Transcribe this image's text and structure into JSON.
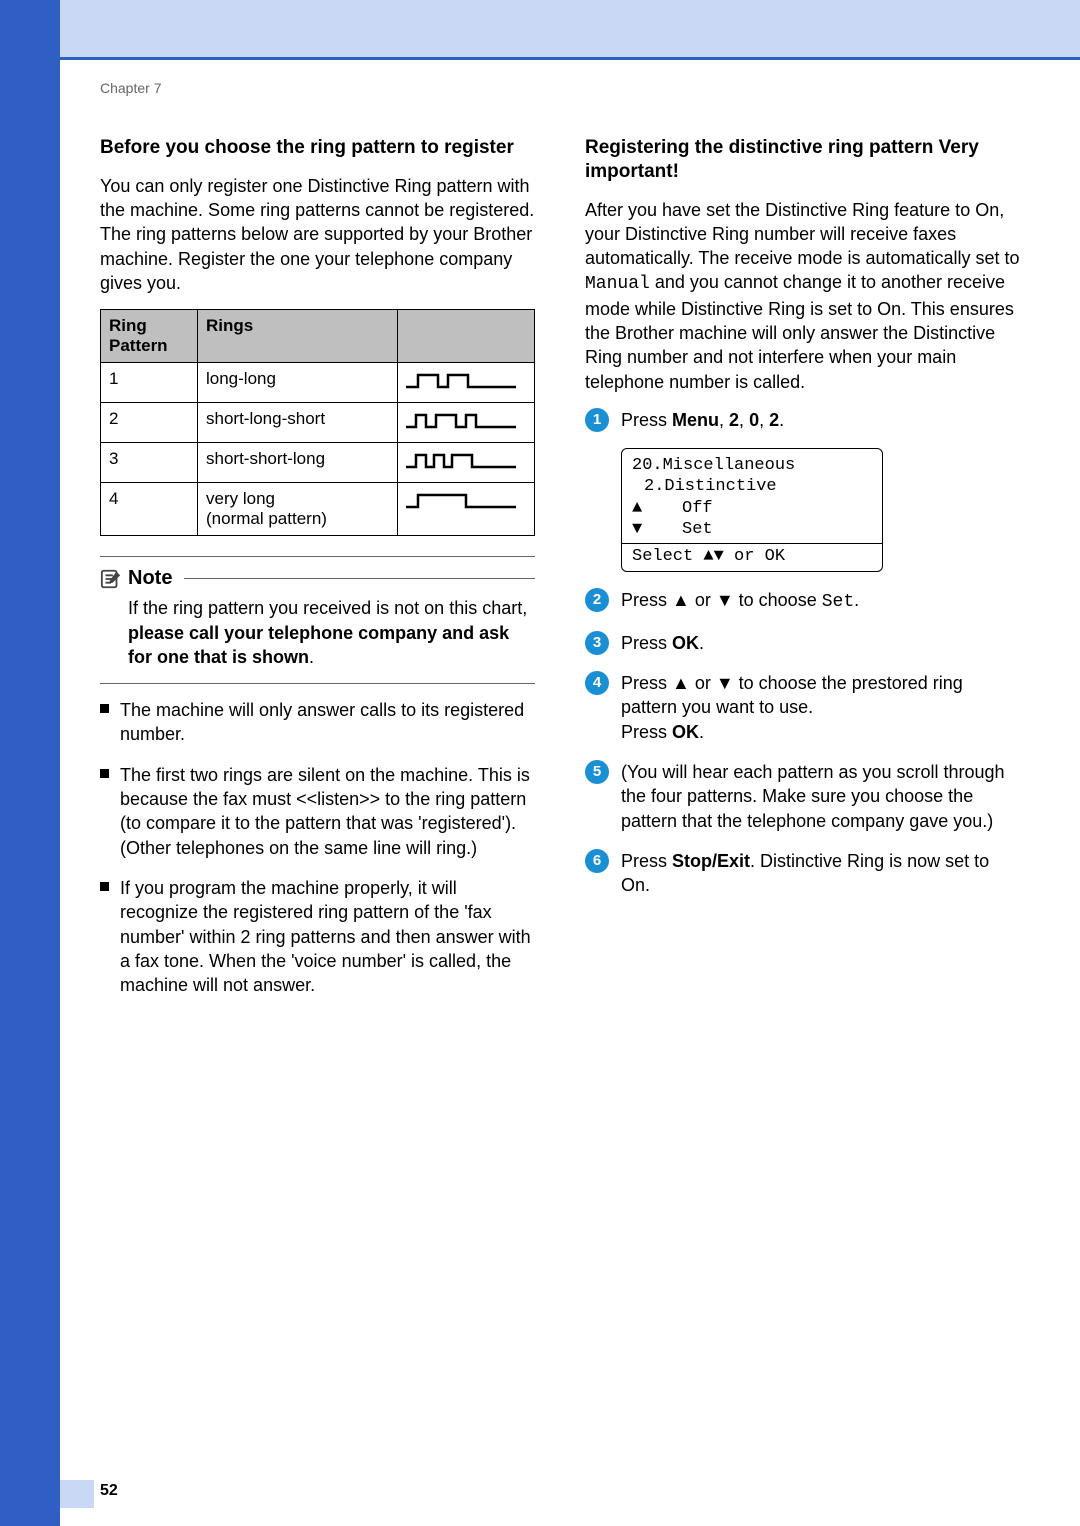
{
  "chapter": "Chapter 7",
  "left": {
    "heading": "Before you choose the ring pattern to register",
    "intro": "You can only register one Distinctive Ring pattern with the machine. Some ring patterns cannot be registered. The ring patterns below are supported by your Brother machine. Register the one your telephone company gives you.",
    "table": {
      "headers": [
        "Ring Pattern",
        "Rings"
      ],
      "rows": [
        {
          "n": "1",
          "desc": "long-long"
        },
        {
          "n": "2",
          "desc": "short-long-short"
        },
        {
          "n": "3",
          "desc": "short-short-long"
        },
        {
          "n": "4",
          "desc": "very long\n(normal pattern)"
        }
      ]
    },
    "note": {
      "label": "Note",
      "text_pre": "If the ring pattern you received is not on this chart, ",
      "text_bold": "please call your telephone company and ask for one that is shown",
      "text_post": "."
    },
    "bullets": [
      "The machine will only answer calls to its registered number.",
      "The first two rings are silent on the machine. This is because the fax must <<listen>> to the ring pattern (to compare it to the pattern that was 'registered'). (Other telephones on the same line will ring.)",
      "If you program the machine properly, it will recognize the registered ring pattern of the 'fax number' within 2 ring patterns and then answer with a fax tone. When the 'voice number' is called, the machine will not answer."
    ]
  },
  "right": {
    "heading": "Registering the distinctive ring pattern Very important!",
    "intro_pre": "After you have set the Distinctive Ring feature to On, your Distinctive Ring number will receive faxes automatically. The receive mode is automatically set to ",
    "intro_mono": "Manual",
    "intro_post": " and you cannot change it to another receive mode while Distinctive Ring is set to On. This ensures the Brother machine will only answer the Distinctive Ring number and not interfere when your main telephone number is called.",
    "lcd": {
      "l1": "20.Miscellaneous",
      "l2": "2.Distinctive",
      "opt1": "Off",
      "opt2": "Set",
      "bottom": "Select ▲▼ or OK"
    },
    "steps": {
      "s1_pre": "Press ",
      "s1_bold": "Menu",
      "s1_post": ", ",
      "s1_b2": "2",
      "s1_c": ", ",
      "s1_b3": "0",
      "s1_c2": ", ",
      "s1_b4": "2",
      "s1_end": ".",
      "s2_pre": "Press ▲ or ▼ to choose ",
      "s2_mono": "Set",
      "s2_post": ".",
      "s3_pre": "Press ",
      "s3_bold": "OK",
      "s3_post": ".",
      "s4_line1": "Press ▲ or ▼ to choose the prestored ring pattern you want to use.",
      "s4_line2_pre": "Press ",
      "s4_line2_bold": "OK",
      "s4_line2_post": ".",
      "s5": "(You will hear each pattern as you scroll through the four patterns. Make sure you choose the pattern that the telephone company gave you.)",
      "s6_pre": "Press ",
      "s6_bold": "Stop/Exit",
      "s6_post": ". Distinctive Ring is now set to On."
    }
  },
  "page_number": "52"
}
